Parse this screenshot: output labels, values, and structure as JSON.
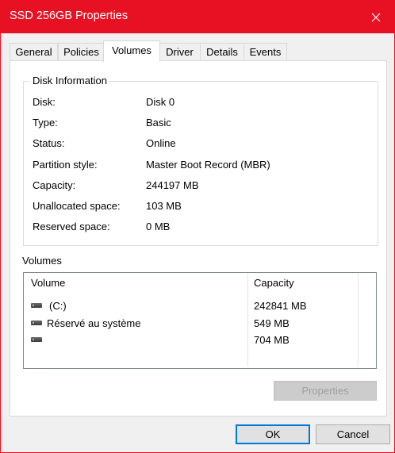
{
  "window": {
    "title": "SSD 256GB Properties"
  },
  "tabs": [
    {
      "label": "General"
    },
    {
      "label": "Policies"
    },
    {
      "label": "Volumes"
    },
    {
      "label": "Driver"
    },
    {
      "label": "Details"
    },
    {
      "label": "Events"
    }
  ],
  "active_tab": "Volumes",
  "disk_info": {
    "legend": "Disk Information",
    "rows": [
      {
        "label": "Disk:",
        "value": "Disk 0"
      },
      {
        "label": "Type:",
        "value": "Basic"
      },
      {
        "label": "Status:",
        "value": "Online"
      },
      {
        "label": "Partition style:",
        "value": "Master Boot Record (MBR)"
      },
      {
        "label": "Capacity:",
        "value": "244197 MB"
      },
      {
        "label": "Unallocated space:",
        "value": "103 MB"
      },
      {
        "label": "Reserved space:",
        "value": "0 MB"
      }
    ]
  },
  "volumes": {
    "label": "Volumes",
    "columns": [
      "Volume",
      "Capacity"
    ],
    "rows": [
      {
        "icon": "drive-icon",
        "name": "(C:)",
        "capacity": "242841 MB"
      },
      {
        "icon": "drive-icon",
        "name": "Réservé au système",
        "capacity": "549 MB"
      },
      {
        "icon": "drive-icon",
        "name": "",
        "capacity": "704 MB"
      }
    ]
  },
  "buttons": {
    "properties": "Properties",
    "ok": "OK",
    "cancel": "Cancel"
  },
  "colors": {
    "accent": "#e81123",
    "focus": "#0078d7"
  }
}
